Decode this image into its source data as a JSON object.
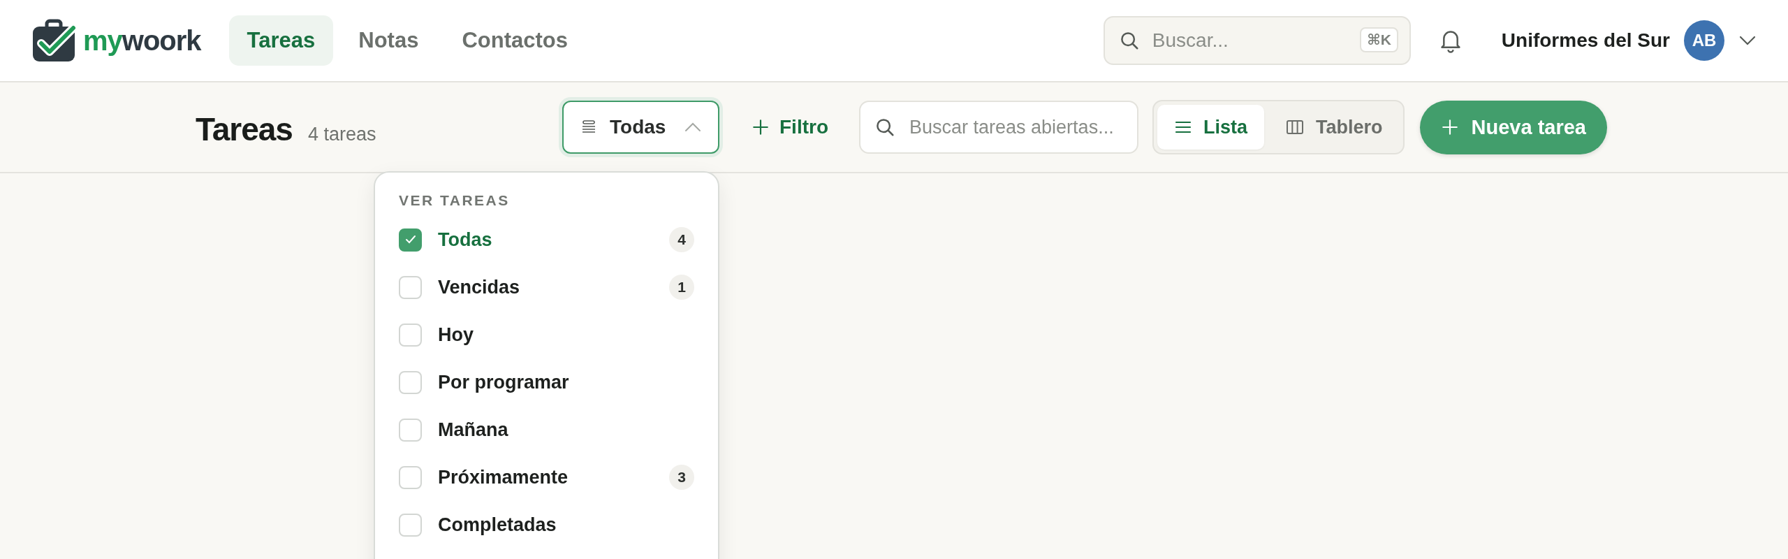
{
  "logo": {
    "part_1": "my",
    "part_2": "woork"
  },
  "nav": [
    {
      "label": "Tareas",
      "selected": true
    },
    {
      "label": "Notas",
      "selected": false
    },
    {
      "label": "Contactos",
      "selected": false
    }
  ],
  "search": {
    "placeholder": "Buscar...",
    "shortcut": "⌘K"
  },
  "account": {
    "name": "Uniformes del Sur",
    "initials": "AB"
  },
  "toolbar": {
    "title": "Tareas",
    "count": "4 tareas",
    "view_filter": {
      "label": "Todas",
      "expanded": true
    },
    "filter_button": {
      "label": "Filtro"
    },
    "search": {
      "placeholder": "Buscar tareas abiertas..."
    },
    "view_modes": [
      {
        "kind": "list",
        "label": "Lista",
        "selected": true
      },
      {
        "kind": "board",
        "label": "Tablero",
        "selected": false
      }
    ],
    "new_button": {
      "label": "Nueva tarea"
    }
  },
  "dropdown": {
    "heading": "VER TAREAS",
    "options": [
      {
        "label": "Todas",
        "checked": true,
        "count": "4"
      },
      {
        "label": "Vencidas",
        "checked": false,
        "count": "1"
      },
      {
        "label": "Hoy",
        "checked": false
      },
      {
        "label": "Por programar",
        "checked": false
      },
      {
        "label": "Mañana",
        "checked": false
      },
      {
        "label": "Próximamente",
        "checked": false,
        "count": "3"
      },
      {
        "label": "Completadas",
        "checked": false
      }
    ]
  }
}
